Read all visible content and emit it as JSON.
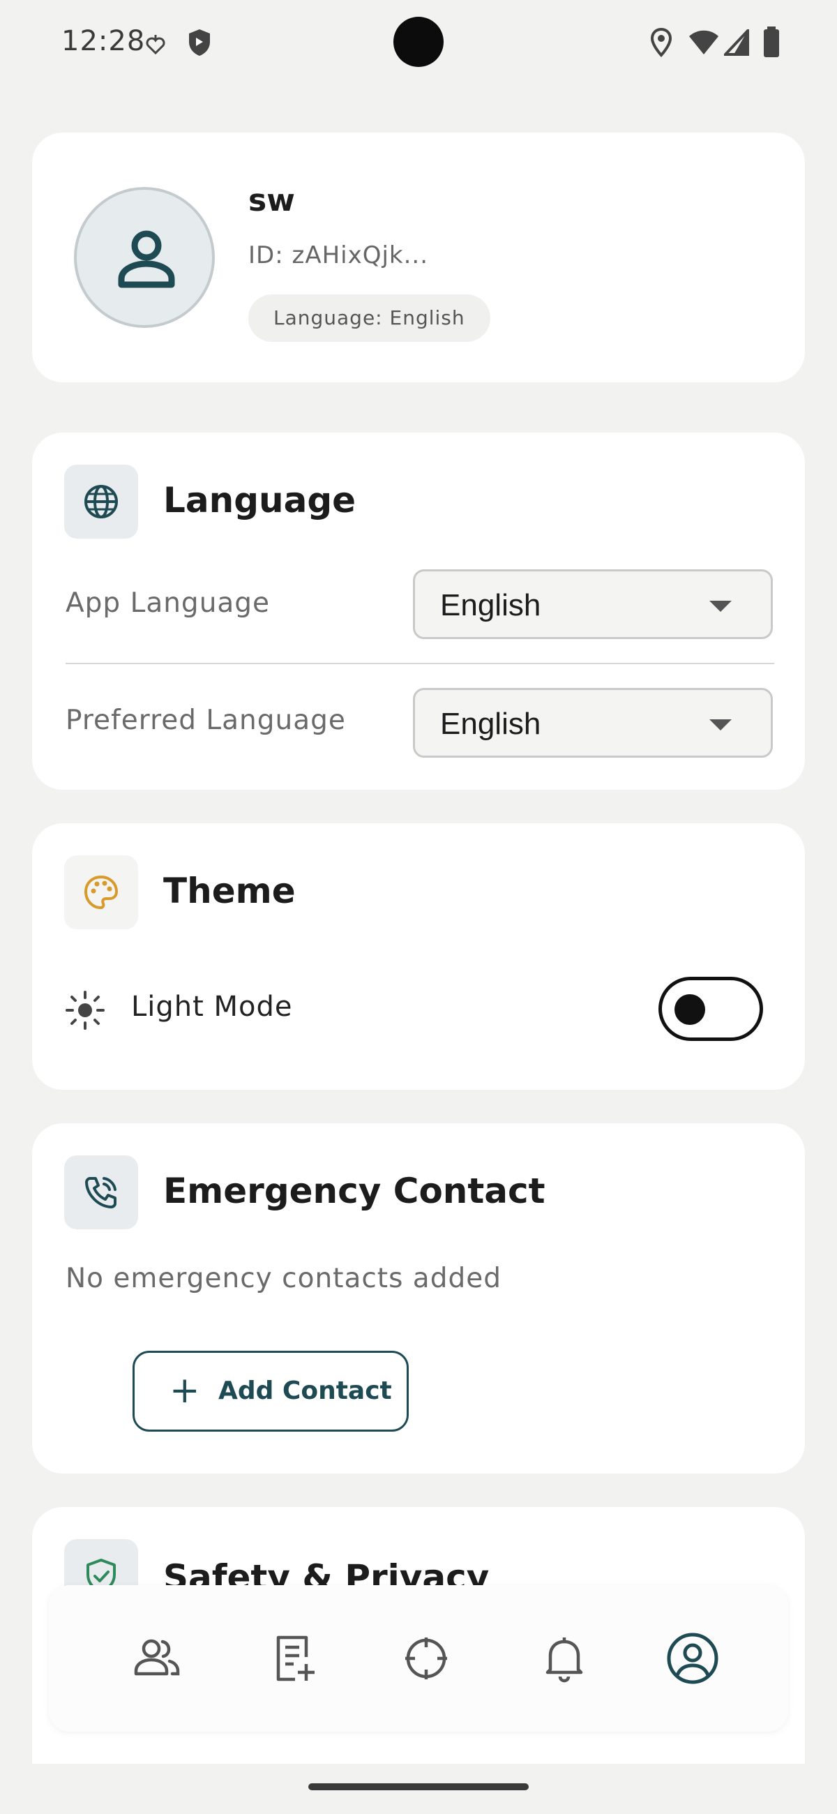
{
  "status_bar": {
    "time": "12:28"
  },
  "profile": {
    "name": "sw",
    "id_text": "ID: zAHixQjk...",
    "language_badge": "Language: English"
  },
  "language_section": {
    "title": "Language",
    "app_language_label": "App Language",
    "app_language_value": "English",
    "preferred_language_label": "Preferred Language",
    "preferred_language_value": "English"
  },
  "theme_section": {
    "title": "Theme",
    "mode_label": "Light Mode",
    "dark_mode_enabled": false
  },
  "emergency_section": {
    "title": "Emergency Contact",
    "empty_text": "No emergency contacts added",
    "add_button_label": "Add Contact",
    "add_button_icon": "+"
  },
  "safety_section": {
    "title": "Safety & Privacy"
  },
  "bottom_nav": {
    "items": [
      {
        "icon": "users-icon"
      },
      {
        "icon": "note-add-icon"
      },
      {
        "icon": "crosshair-icon"
      },
      {
        "icon": "bell-icon"
      },
      {
        "icon": "profile-icon",
        "active": true
      }
    ]
  },
  "colors": {
    "accent": "#1e4a54",
    "background": "#f2f2f1",
    "card": "#ffffff",
    "palette_icon": "#d89a2b",
    "shield_icon": "#2e8a5a"
  }
}
